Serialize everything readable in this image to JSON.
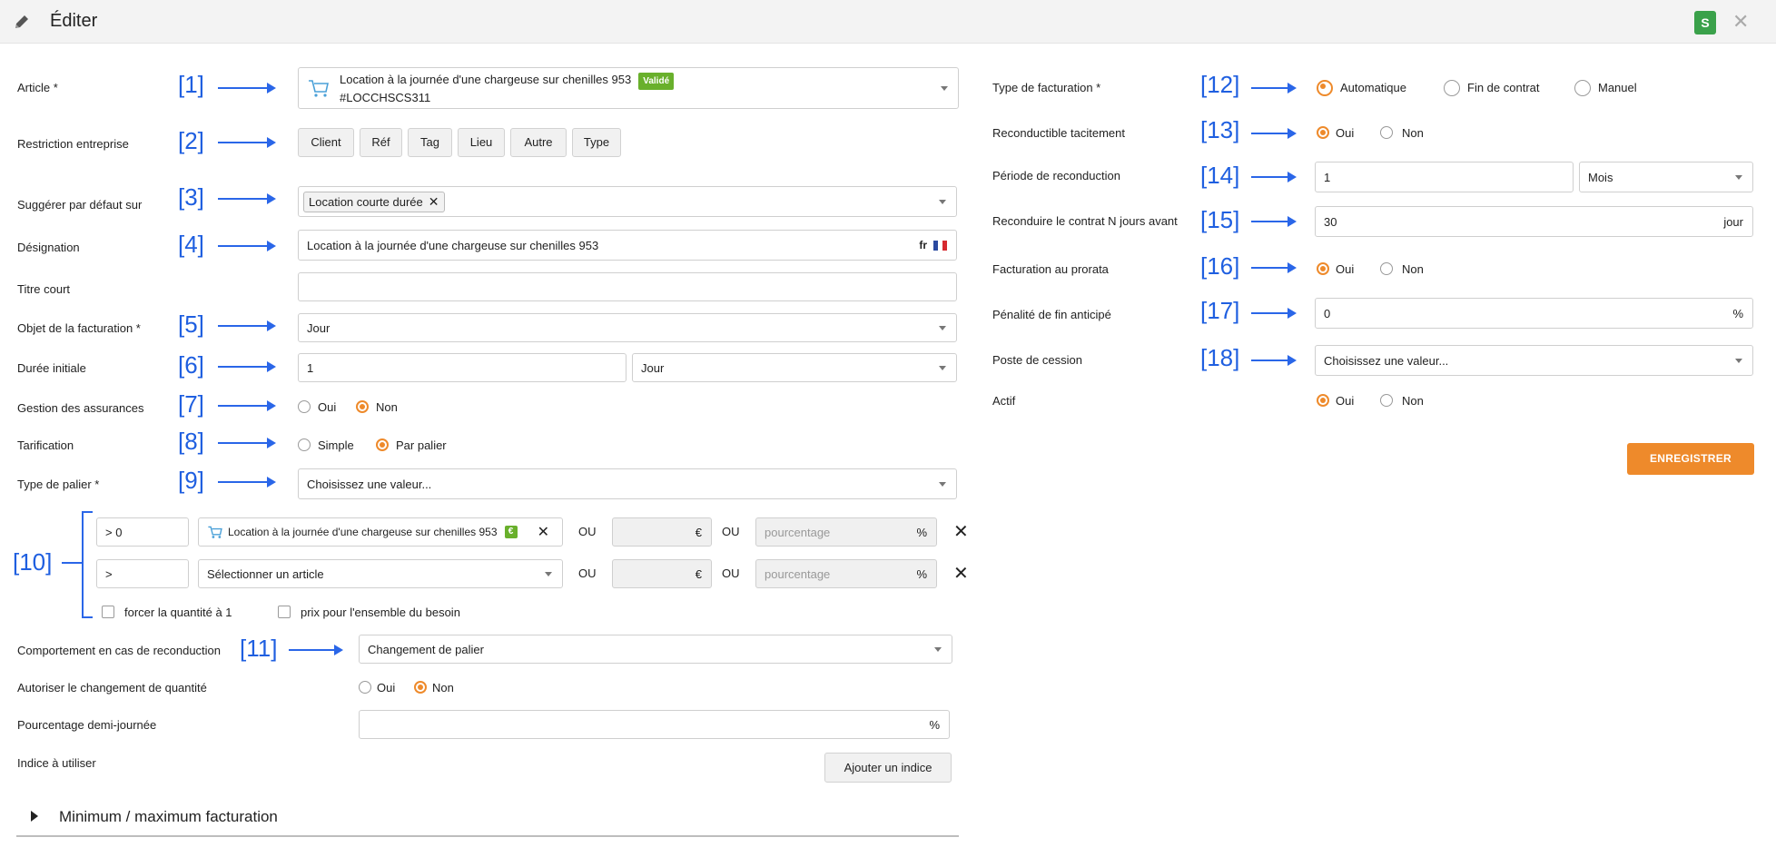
{
  "header": {
    "title": "Éditer",
    "badge": "S",
    "close": "✕",
    "edit_icon": "pencil-icon"
  },
  "annotations": [
    "[1]",
    "[2]",
    "[3]",
    "[4]",
    "[5]",
    "[6]",
    "[7]",
    "[8]",
    "[9]",
    "[10]",
    "[11]",
    "[12]",
    "[13]",
    "[14]",
    "[15]",
    "[16]",
    "[17]",
    "[18]"
  ],
  "left": {
    "article": {
      "label": "Article *",
      "value": "Location à la journée d'une chargeuse sur chenilles 953",
      "status": "Validé",
      "code": "#LOCCHSCS311",
      "icon": "cart-icon"
    },
    "restriction": {
      "label": "Restriction entreprise",
      "buttons": [
        "Client",
        "Réf",
        "Tag",
        "Lieu",
        "Autre",
        "Type"
      ]
    },
    "suggest": {
      "label": "Suggérer par défaut sur",
      "tag": "Location courte durée",
      "tag_remove": "✕"
    },
    "designation": {
      "label": "Désignation",
      "value": "Location à la journée d'une chargeuse sur chenilles 953",
      "lang": "fr"
    },
    "short_title": {
      "label": "Titre court",
      "value": ""
    },
    "billing_object": {
      "label": "Objet de la facturation *",
      "value": "Jour"
    },
    "initial_duration": {
      "label": "Durée initiale",
      "value": "1",
      "unit": "Jour"
    },
    "insurance": {
      "label": "Gestion des assurances",
      "options": [
        "Oui",
        "Non"
      ],
      "selected": "Non"
    },
    "pricing": {
      "label": "Tarification",
      "options": [
        "Simple",
        "Par palier"
      ],
      "selected": "Par palier"
    },
    "tier_type": {
      "label": "Type de palier *",
      "value": "Choisissez une valeur..."
    },
    "tiers": {
      "rows": [
        {
          "threshold": "> 0",
          "article": "Location à la journée d'une chargeuse sur chenilles 953",
          "article_badge": "€",
          "or1": "OU",
          "price_suffix": "€",
          "or2": "OU",
          "percent_placeholder": "pourcentage",
          "percent_suffix": "%",
          "remove": "✕"
        },
        {
          "threshold": ">",
          "article": "Sélectionner un article",
          "or1": "OU",
          "price_suffix": "€",
          "or2": "OU",
          "percent_placeholder": "pourcentage",
          "percent_suffix": "%",
          "remove": "✕"
        }
      ],
      "force_qty": "forcer la quantité à 1",
      "price_whole": "prix pour l'ensemble du besoin"
    },
    "renewal_behavior": {
      "label": "Comportement en cas de reconduction",
      "value": "Changement de palier"
    },
    "allow_qty_change": {
      "label": "Autoriser le changement de quantité",
      "options": [
        "Oui",
        "Non"
      ],
      "selected": "Non"
    },
    "half_day_pct": {
      "label": "Pourcentage demi-journée",
      "value": "",
      "suffix": "%"
    },
    "index": {
      "label": "Indice à utiliser",
      "button": "Ajouter un indice"
    },
    "collapse": {
      "label": "Minimum / maximum facturation"
    }
  },
  "right": {
    "billing_type": {
      "label": "Type de facturation *",
      "options": [
        "Automatique",
        "Fin de contrat",
        "Manuel"
      ],
      "selected": "Automatique"
    },
    "tacit_renewal": {
      "label": "Reconductible tacitement",
      "options": [
        "Oui",
        "Non"
      ],
      "selected": "Oui"
    },
    "renewal_period": {
      "label": "Période de reconduction",
      "value": "1",
      "unit": "Mois"
    },
    "renew_days_before": {
      "label": "Reconduire le contrat N jours avant",
      "value": "30",
      "suffix": "jour"
    },
    "prorata": {
      "label": "Facturation au prorata",
      "options": [
        "Oui",
        "Non"
      ],
      "selected": "Oui"
    },
    "early_end_penalty": {
      "label": "Pénalité de fin anticipé",
      "value": "0",
      "suffix": "%"
    },
    "cession_post": {
      "label": "Poste de cession",
      "value": "Choisissez une valeur..."
    },
    "active": {
      "label": "Actif",
      "options": [
        "Oui",
        "Non"
      ],
      "selected": "Oui"
    },
    "save": "ENREGISTRER"
  }
}
